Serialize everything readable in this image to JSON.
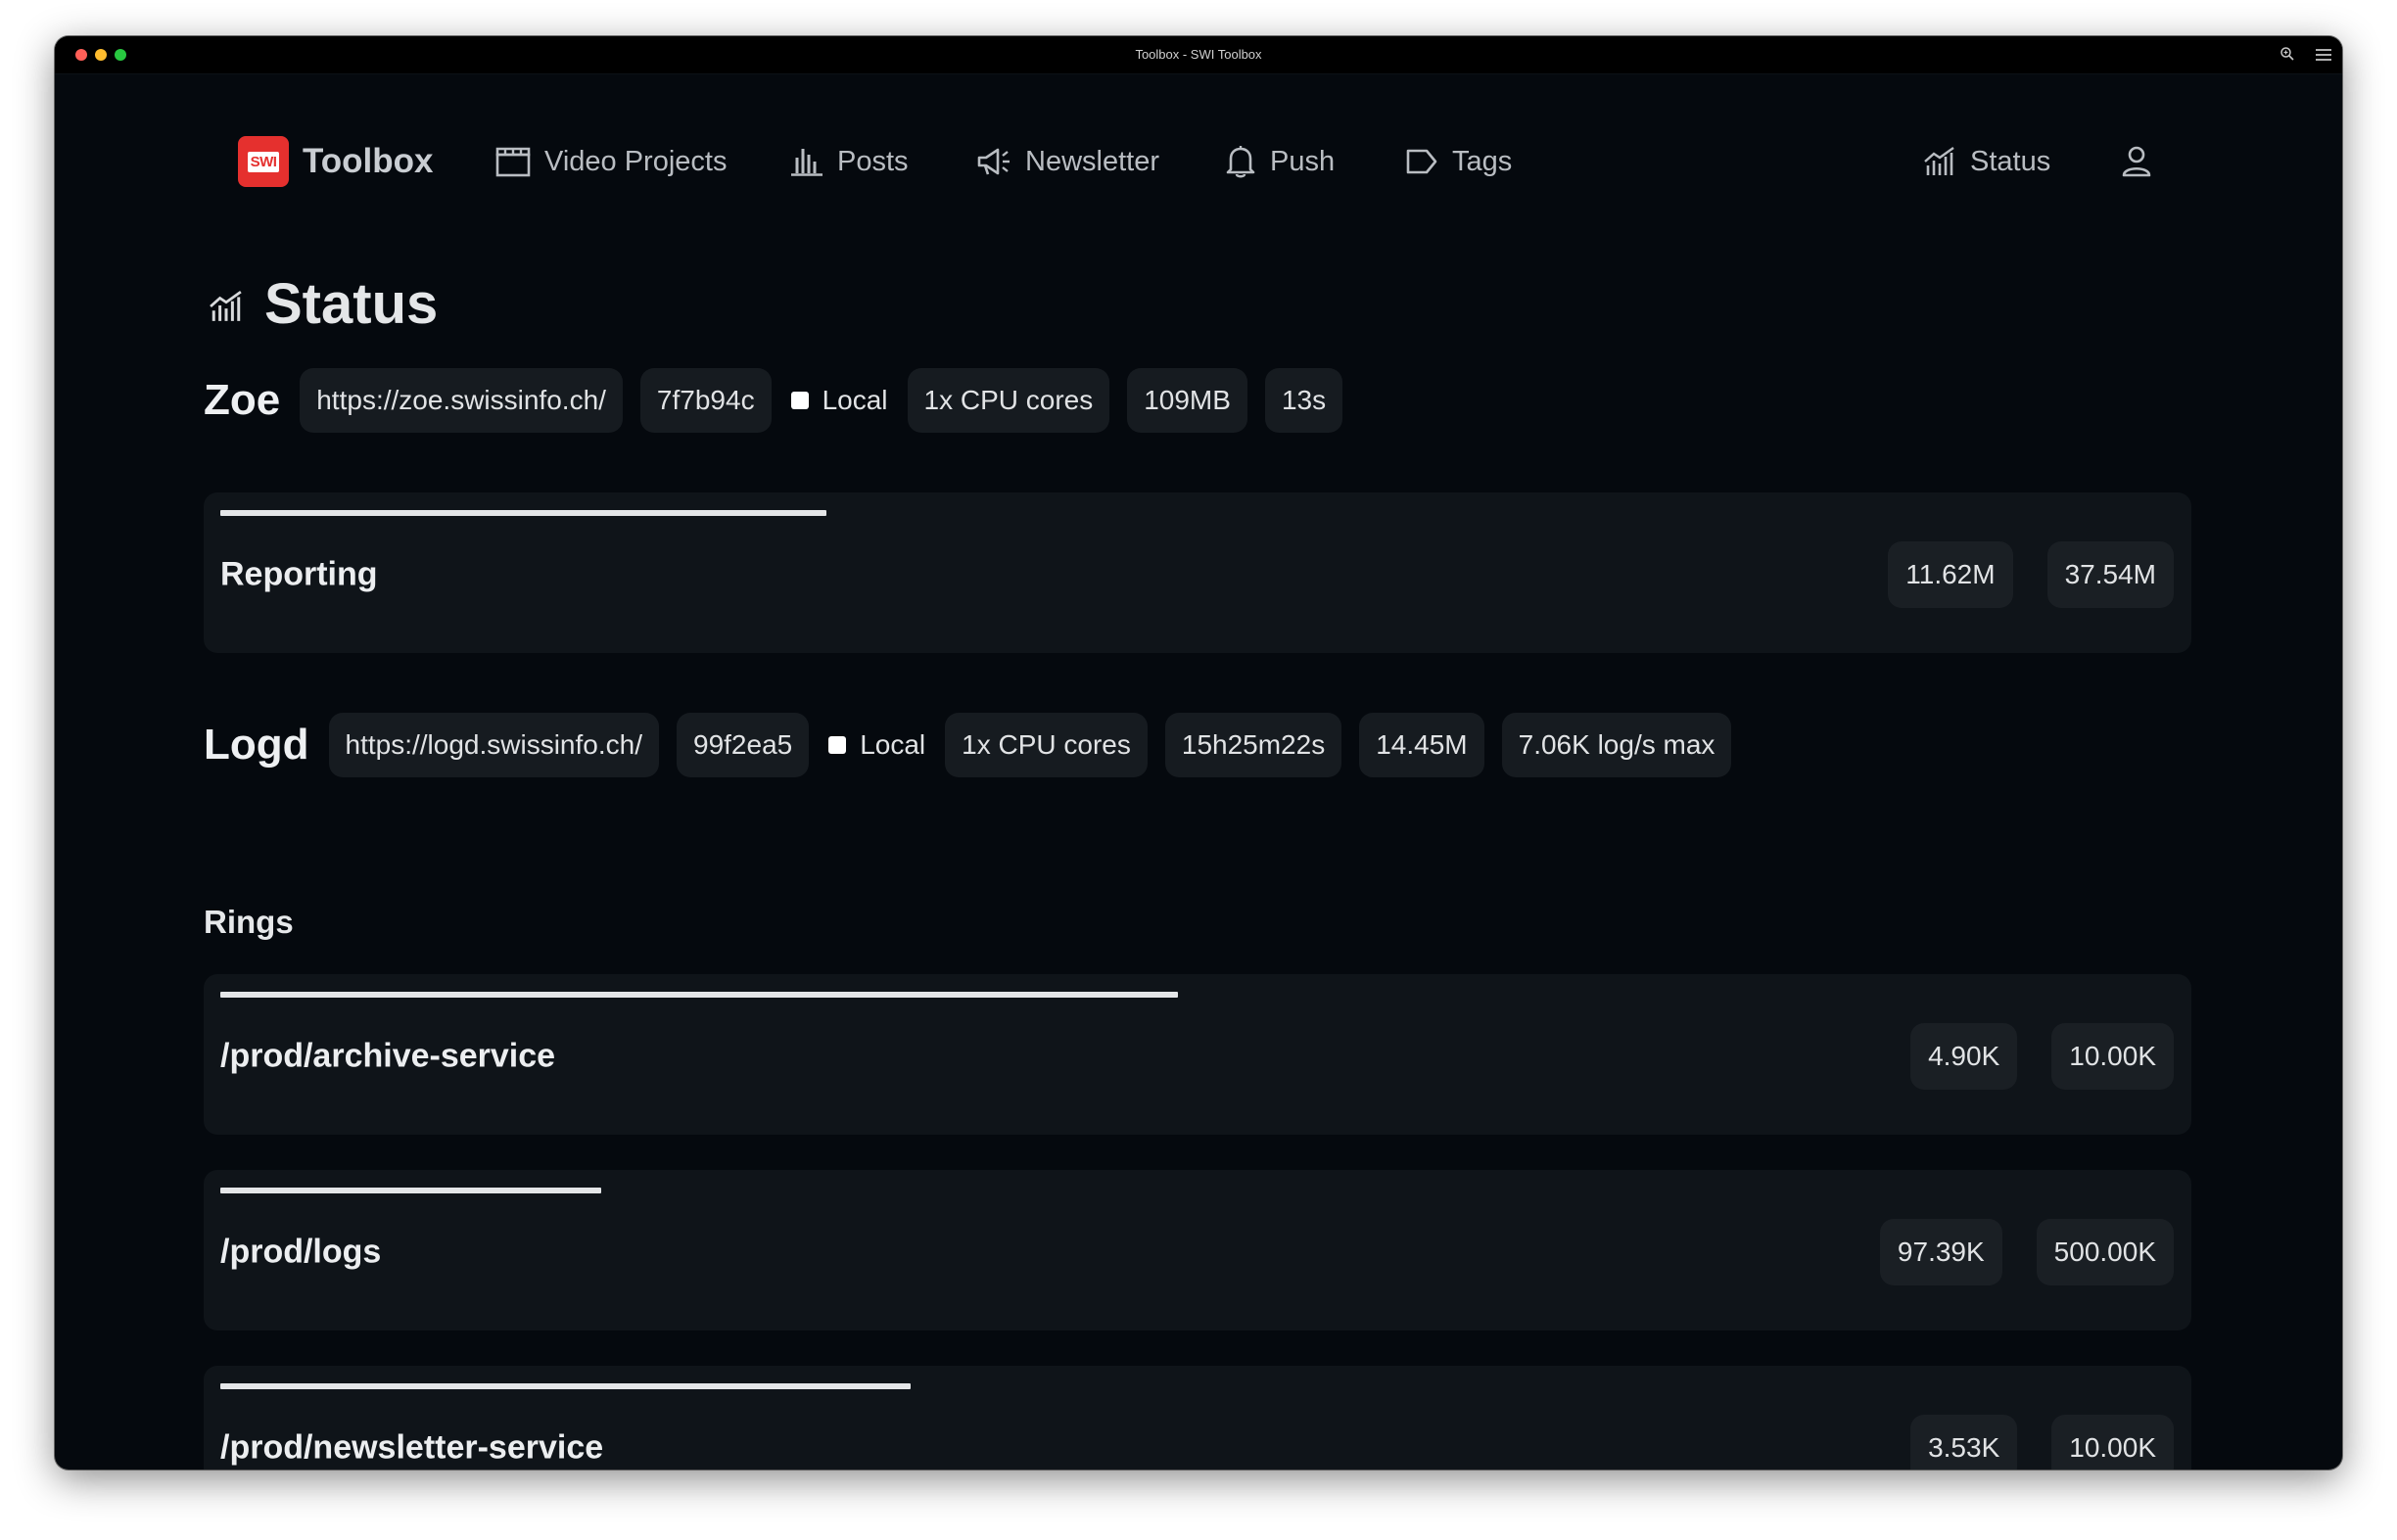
{
  "window": {
    "title": "Toolbox - SWI Toolbox"
  },
  "nav": {
    "brand": {
      "logo_text": "SWI",
      "label": "Toolbox",
      "icon": "swi-logo"
    },
    "items": [
      {
        "label": "Video Projects",
        "icon": "clapperboard-icon"
      },
      {
        "label": "Posts",
        "icon": "bar-chart-icon"
      },
      {
        "label": "Newsletter",
        "icon": "megaphone-icon"
      },
      {
        "label": "Push",
        "icon": "bell-icon"
      },
      {
        "label": "Tags",
        "icon": "tag-icon"
      }
    ],
    "status": {
      "label": "Status",
      "icon": "chart-line-icon"
    },
    "user": {
      "icon": "user-icon"
    }
  },
  "page": {
    "title": "Status",
    "icon": "chart-line-icon"
  },
  "zoe": {
    "name": "Zoe",
    "url": "https://zoe.swissinfo.ch/",
    "commit": "7f7b94c",
    "local_label": "Local",
    "local_checked": false,
    "cpu": "1x CPU cores",
    "memory": "109MB",
    "uptime": "13s",
    "reporting": {
      "label": "Reporting",
      "used": "11.62M",
      "total": "37.54M",
      "fill_fraction": 0.31
    }
  },
  "logd": {
    "name": "Logd",
    "url": "https://logd.swissinfo.ch/",
    "commit": "99f2ea5",
    "local_label": "Local",
    "local_checked": false,
    "cpu": "1x CPU cores",
    "uptime": "15h25m22s",
    "memory": "14.45M",
    "rate": "7.06K log/s max"
  },
  "rings": {
    "heading": "Rings",
    "items": [
      {
        "label": "/prod/archive-service",
        "used": "4.90K",
        "total": "10.00K",
        "fill_fraction": 0.49
      },
      {
        "label": "/prod/logs",
        "used": "97.39K",
        "total": "500.00K",
        "fill_fraction": 0.195
      },
      {
        "label": "/prod/newsletter-service",
        "used": "3.53K",
        "total": "10.00K",
        "fill_fraction": 0.353
      }
    ]
  },
  "colors": {
    "background": "#05090e",
    "card": "#0f1419",
    "pill": "#161b20",
    "text": "#e1e3e5",
    "nav_text": "#b9bdc2",
    "brand_red": "#e5302e",
    "bar": "#e4e6e8"
  }
}
